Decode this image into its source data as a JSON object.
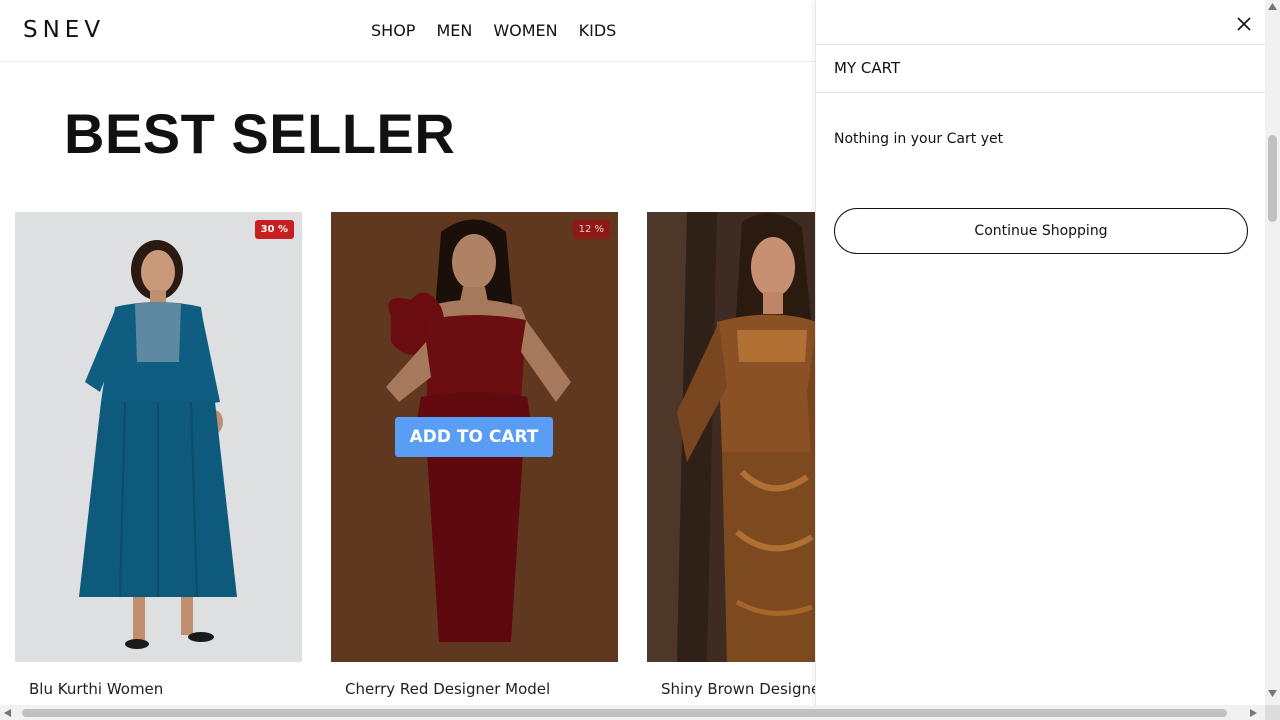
{
  "header": {
    "logo": "SNEV",
    "nav": [
      "SHOP",
      "MEN",
      "WOMEN",
      "KIDS"
    ]
  },
  "section": {
    "title": "BEST SELLER"
  },
  "products": [
    {
      "name": "Blu Kurthi Women",
      "discount": "30 %"
    },
    {
      "name": "Cherry Red Designer Model",
      "discount": "12 %",
      "button": "ADD TO CART"
    },
    {
      "name": "Shiny Brown Designer"
    }
  ],
  "cart": {
    "title": "MY CART",
    "empty_message": "Nothing in your Cart yet",
    "continue_label": "Continue Shopping"
  },
  "colors": {
    "accent_button": "#5a9df5",
    "discount_badge": "#c81e1e"
  }
}
